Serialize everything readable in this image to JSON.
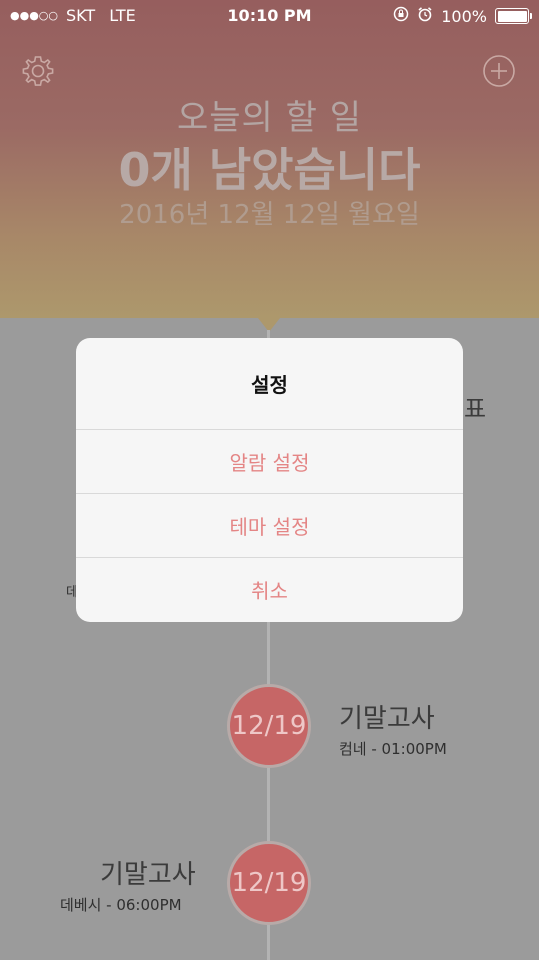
{
  "status_bar": {
    "signal": "●●●○○",
    "carrier": "SKT",
    "network": "LTE",
    "time": "10:10 PM",
    "battery": "100%",
    "battery_level": 1.0
  },
  "header": {
    "title": "오늘의 할 일",
    "count": "0개 남았습니다",
    "date": "2016년 12월 12일 월요일"
  },
  "timeline": {
    "partial_right_glyph": "표",
    "partial_left_glyph": "데",
    "events": [
      {
        "date": "12/19",
        "title": "기말고사",
        "detail": "컴네 - 01:00PM"
      },
      {
        "date": "12/19",
        "title": "기말고사",
        "detail": "데베시 - 06:00PM"
      }
    ]
  },
  "dialog": {
    "title": "설정",
    "options": [
      "알람 설정",
      "테마 설정",
      "취소"
    ]
  },
  "colors": {
    "accent": "#e48585",
    "node": "#c66666"
  }
}
